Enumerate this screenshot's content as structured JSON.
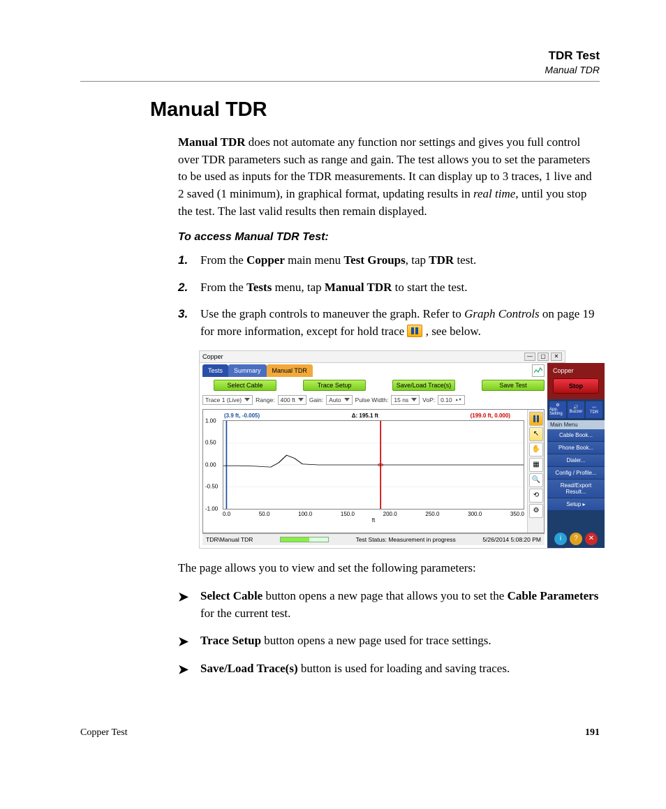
{
  "header": {
    "chapter": "TDR Test",
    "section": "Manual TDR"
  },
  "h1": "Manual TDR",
  "intro": {
    "lead_bold": "Manual TDR",
    "p1a": " does not automate any function nor settings and gives you full control over TDR parameters such as range and gain. The test allows you to set the parameters to be used as inputs for the TDR measurements. It can display up to 3 traces, 1 live and 2 saved (1 minimum), in graphical format, updating results in ",
    "p1_italic": "real time",
    "p1b": ", until you stop the test. The last valid results then remain displayed."
  },
  "subhead": "To access Manual TDR Test:",
  "steps": [
    {
      "num": "1.",
      "pre": "From the ",
      "b1": "Copper",
      "mid1": " main menu ",
      "b2": "Test Groups",
      "mid2": ", tap ",
      "b3": "TDR",
      "post": " test."
    },
    {
      "num": "2.",
      "pre": "From the ",
      "b1": "Tests",
      "mid1": " menu, tap ",
      "b2": "Manual TDR",
      "post": " to start the test."
    },
    {
      "num": "3.",
      "pre": "Use the graph controls to maneuver the graph. Refer to ",
      "i1": "Graph Controls",
      "mid1": " on page 19 for more information, except for hold trace ",
      "post": ", see below."
    }
  ],
  "screenshot": {
    "window_title": "Copper",
    "tabs": {
      "t1": "Tests",
      "t2": "Summary",
      "t3": "Manual TDR"
    },
    "green_buttons": [
      "Select Cable",
      "Trace Setup",
      "Save/Load Trace(s)",
      "Save Test"
    ],
    "params": {
      "trace_label": "Trace 1 (Live)",
      "range_label": "Range:",
      "range_value": "400 ft",
      "gain_label": "Gain:",
      "gain_value": "Auto",
      "pw_label": "Pulse Width:",
      "pw_value": "15 ns",
      "vop_label": "VoP:",
      "vop_value": "0.10"
    },
    "cursors": {
      "blue": "(3.9 ft, -0.005)",
      "delta": "Δ: 195.1 ft",
      "red": "(199.0 ft, 0.000)"
    },
    "yticks": [
      "1.00",
      "0.50",
      "0.00",
      "-0.50",
      "-1.00"
    ],
    "xticks": [
      "0.0",
      "50.0",
      "100.0",
      "150.0",
      "200.0",
      "250.0",
      "300.0",
      "350.0"
    ],
    "xlabel": "ft",
    "footer": {
      "path": "TDR\\Manual TDR",
      "status": "Test Status: Measurement in progress",
      "time": "5/26/2014 5:08:20 PM"
    },
    "side": {
      "app": "Copper",
      "stop": "Stop",
      "icons": [
        "App. Setting",
        "Buzzer",
        "TDR"
      ],
      "main_menu": "Main Menu",
      "items": [
        "Cable Book...",
        "Phone Book...",
        "Dialer...",
        "Config / Profile...",
        "Read/Export Result...",
        "Setup    ▸"
      ]
    }
  },
  "chart_data": {
    "type": "line",
    "title": "",
    "xlabel": "ft",
    "ylabel": "",
    "xlim": [
      0,
      380
    ],
    "ylim": [
      -1.0,
      1.0
    ],
    "cursors": [
      {
        "name": "blue",
        "x": 3.9,
        "y": -0.005
      },
      {
        "name": "red",
        "x": 199.0,
        "y": 0.0
      }
    ],
    "delta": 195.1,
    "series": [
      {
        "name": "Trace 1 (Live)",
        "x": [
          0,
          20,
          40,
          60,
          70,
          80,
          90,
          100,
          120,
          150,
          200,
          250,
          300,
          350,
          380
        ],
        "y": [
          -0.02,
          -0.02,
          -0.03,
          -0.05,
          0.05,
          0.22,
          0.15,
          0.02,
          0.0,
          0.0,
          0.0,
          0.0,
          0.0,
          0.0,
          0.0
        ]
      }
    ]
  },
  "para_below": "The page allows you to view and set the following parameters:",
  "bullets": [
    {
      "b1": "Select Cable",
      "mid": " button opens a new page that allows you to set the ",
      "b2": "Cable Parameters",
      "post": " for the current test."
    },
    {
      "b1": "Trace Setup",
      "post": " button opens a new page used for trace settings."
    },
    {
      "b1": "Save/Load Trace(s)",
      "post": " button is used for loading and saving traces."
    }
  ],
  "footer": {
    "left": "Copper Test",
    "page": "191"
  }
}
